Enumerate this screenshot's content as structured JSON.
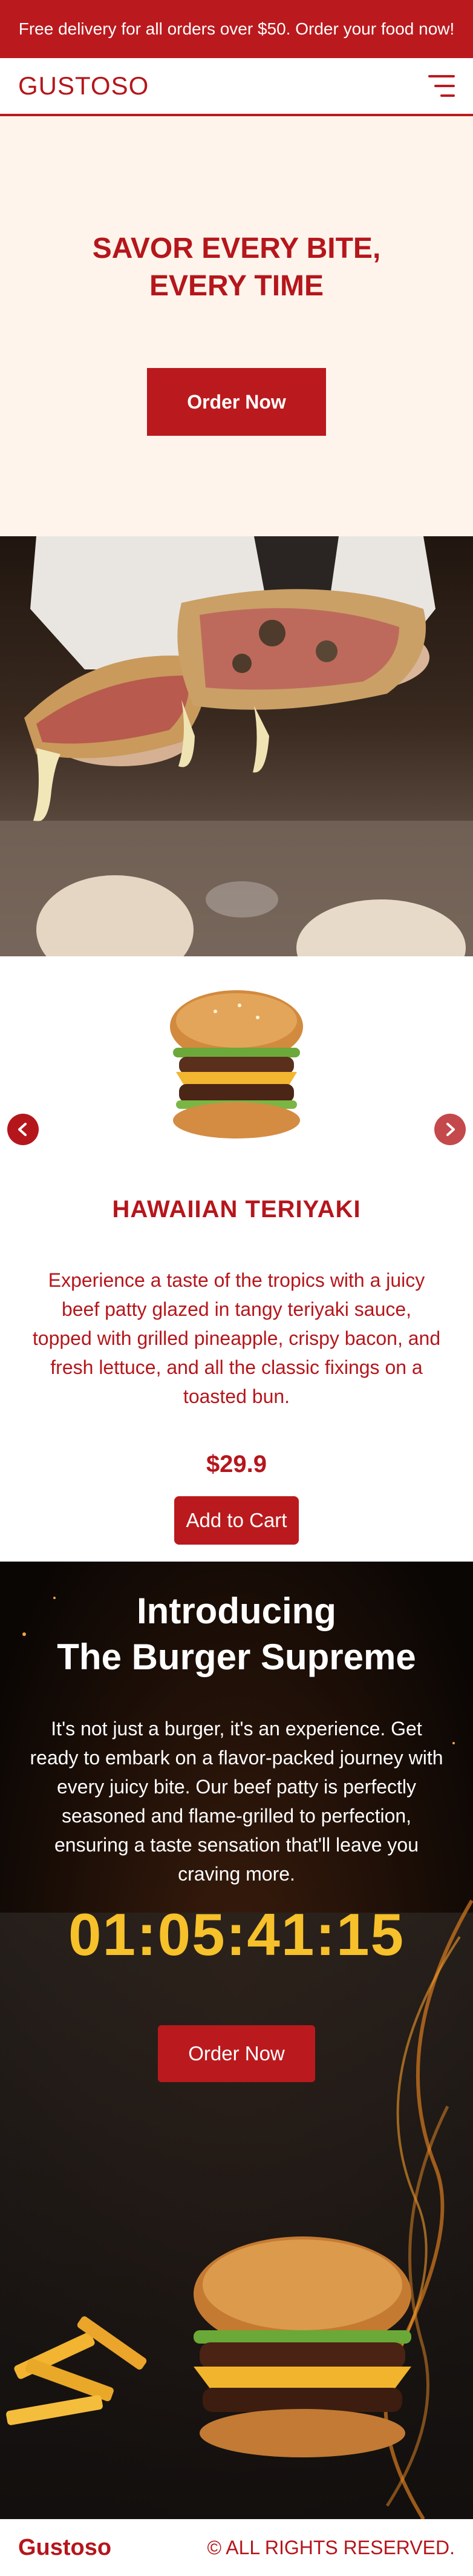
{
  "promo": {
    "text": "Free delivery for all orders over $50. Order your food now!"
  },
  "header": {
    "logo": "GUSTOSO",
    "menu_icon": "hamburger-menu-icon"
  },
  "hero": {
    "title": "SAVOR EVERY BITE, EVERY TIME",
    "cta": "Order Now"
  },
  "product": {
    "name": "HAWAIIAN TERIYAKI",
    "description": "Experience a taste of the tropics with a juicy beef patty glazed in tangy teriyaki sauce, topped with grilled pineapple, crispy bacon, and fresh lettuce, and all the classic fixings on a toasted bun.",
    "price": "$29.9",
    "add_to_cart": "Add to Cart",
    "prev_icon": "chevron-left-icon",
    "next_icon": "chevron-right-icon"
  },
  "supreme": {
    "title_line1": "Introducing",
    "title_line2": "The Burger Supreme",
    "description": "It's not just a burger, it's an experience. Get ready to embark on a flavor-packed journey with every juicy bite. Our beef patty is perfectly seasoned and flame-grilled to perfection, ensuring a taste sensation that'll leave you craving more.",
    "countdown": "01:05:41:15",
    "cta": "Order Now"
  },
  "footer": {
    "logo": "Gustoso",
    "copyright": "© ALL RIGHTS RESERVED."
  },
  "colors": {
    "brand_red": "#ba1a1e",
    "cream": "#fef4eb",
    "countdown_gold": "#f6c12a",
    "dark": "#0c0705"
  }
}
